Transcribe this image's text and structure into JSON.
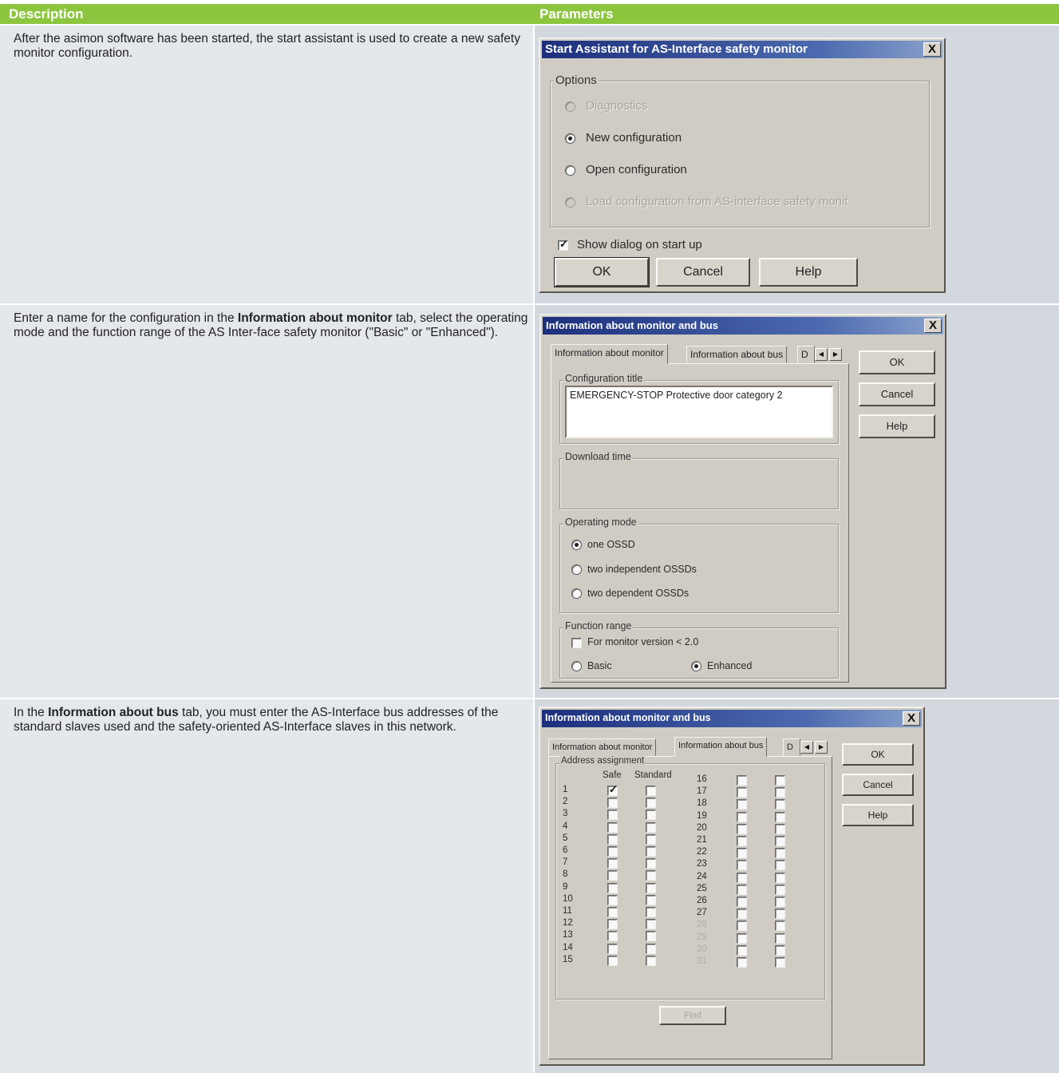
{
  "header": {
    "description": "Description",
    "parameters": "Parameters"
  },
  "rows": [
    {
      "text": "After the asimon software has been started, the start assistant is used to create a new safety monitor configuration."
    },
    {
      "text_before": "Enter a name for the configuration in the ",
      "bold": "Information about monitor",
      "text_after": " tab, select the operating mode and the function range of the AS Inter-face safety monitor (\"Basic\" or \"Enhanced\")."
    },
    {
      "text_before": "In the ",
      "bold": "Information about bus",
      "text_after": " tab, you must enter the AS-Interface bus addresses of the standard slaves used and the safety-oriented AS-Interface slaves in this network."
    }
  ],
  "dialog1": {
    "title": "Start Assistant for AS-Interface safety monitor",
    "close": "X",
    "group": "Options",
    "options": [
      {
        "label": "Diagnostics",
        "state": "disabled"
      },
      {
        "label": "New configuration",
        "state": "selected"
      },
      {
        "label": "Open configuration",
        "state": "normal"
      },
      {
        "label": "Load configuration from AS-interface safety monit",
        "state": "disabled"
      }
    ],
    "checkbox_label": "Show dialog on start up",
    "checkbox_checked": true,
    "buttons": {
      "ok": "OK",
      "cancel": "Cancel",
      "help": "Help"
    }
  },
  "dialog2": {
    "title": "Information about monitor and bus",
    "close": "X",
    "tabs": [
      "Information about monitor",
      "Information about bus",
      "D"
    ],
    "buttons": {
      "ok": "OK",
      "cancel": "Cancel",
      "help": "Help"
    },
    "config_title_label": "Configuration title",
    "config_title_value": "EMERGENCY-STOP Protective door category 2",
    "download_time_label": "Download time",
    "operating_mode_label": "Operating mode",
    "operating_modes": [
      {
        "label": "one OSSD",
        "selected": true
      },
      {
        "label": "two independent OSSDs",
        "selected": false
      },
      {
        "label": "two dependent OSSDs",
        "selected": false
      }
    ],
    "function_range_label": "Function range",
    "monitor_version_checkbox": "For monitor version < 2.0",
    "range_basic": "Basic",
    "range_enhanced": "Enhanced",
    "range_selected": "Enhanced"
  },
  "dialog3": {
    "title": "Information about monitor and bus",
    "close": "X",
    "tabs": [
      "Information about monitor",
      "Information about bus",
      "D"
    ],
    "buttons": {
      "ok": "OK",
      "cancel": "Cancel",
      "help": "Help"
    },
    "group": "Address assignment",
    "col_safe": "Safe",
    "col_standard": "Standard",
    "left_addresses": [
      "1",
      "2",
      "3",
      "4",
      "5",
      "6",
      "7",
      "8",
      "9",
      "10",
      "11",
      "12",
      "13",
      "14",
      "15"
    ],
    "right_addresses": [
      "16",
      "17",
      "18",
      "19",
      "20",
      "21",
      "22",
      "23",
      "24",
      "25",
      "26",
      "27",
      "28",
      "29",
      "30",
      "31"
    ],
    "safe_checked_address": "1",
    "find_button": "Find"
  }
}
